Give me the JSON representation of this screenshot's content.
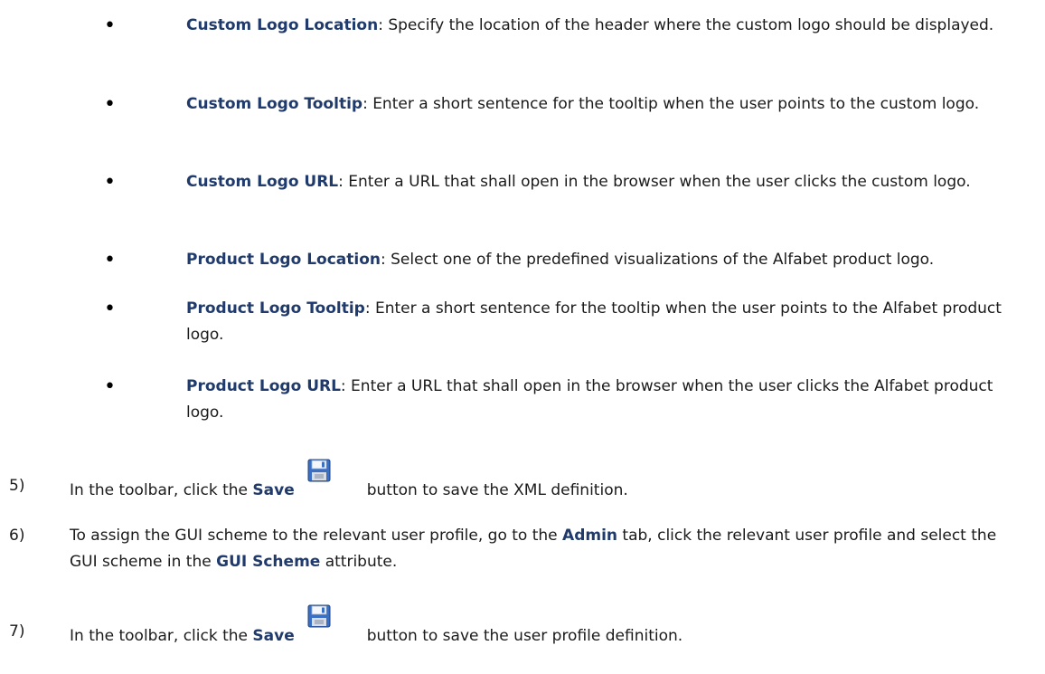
{
  "bullets": [
    {
      "term": "Custom Logo Location",
      "text": ": Specify the location of the header where the custom logo should be displayed."
    },
    {
      "term": "Custom Logo Tooltip",
      "text": ": Enter a short sentence for the tooltip when the user points to the custom logo."
    },
    {
      "term": "Custom Logo URL",
      "text": ": Enter a URL that shall open in the browser when the user clicks the custom logo."
    },
    {
      "term": "Product Logo Location",
      "text": ": Select one of the predefined visualizations of the Alfabet product logo."
    },
    {
      "term": "Product Logo Tooltip",
      "text": ": Enter a short sentence for the tooltip when the user points to the Alfabet product logo."
    },
    {
      "term": "Product Logo URL",
      "text": ": Enter a URL that shall open in the browser when the user clicks the Alfabet product logo."
    }
  ],
  "steps": {
    "s5": {
      "num": "5)",
      "pre": "In the toolbar, click the ",
      "kw": "Save",
      "post": "button to save the XML definition.",
      "icon": "save-floppy-icon"
    },
    "s6": {
      "num": "6)",
      "pre": "To assign the GUI scheme to the relevant user profile, go to the ",
      "kw1": "Admin",
      "mid": " tab, click the relevant user profile and select the GUI scheme in the ",
      "kw2": "GUI Scheme",
      "post": " attribute."
    },
    "s7": {
      "num": "7)",
      "pre": "In the toolbar, click the ",
      "kw": "Save",
      "post": "button to save the user profile definition.",
      "icon": "save-floppy-icon"
    }
  }
}
